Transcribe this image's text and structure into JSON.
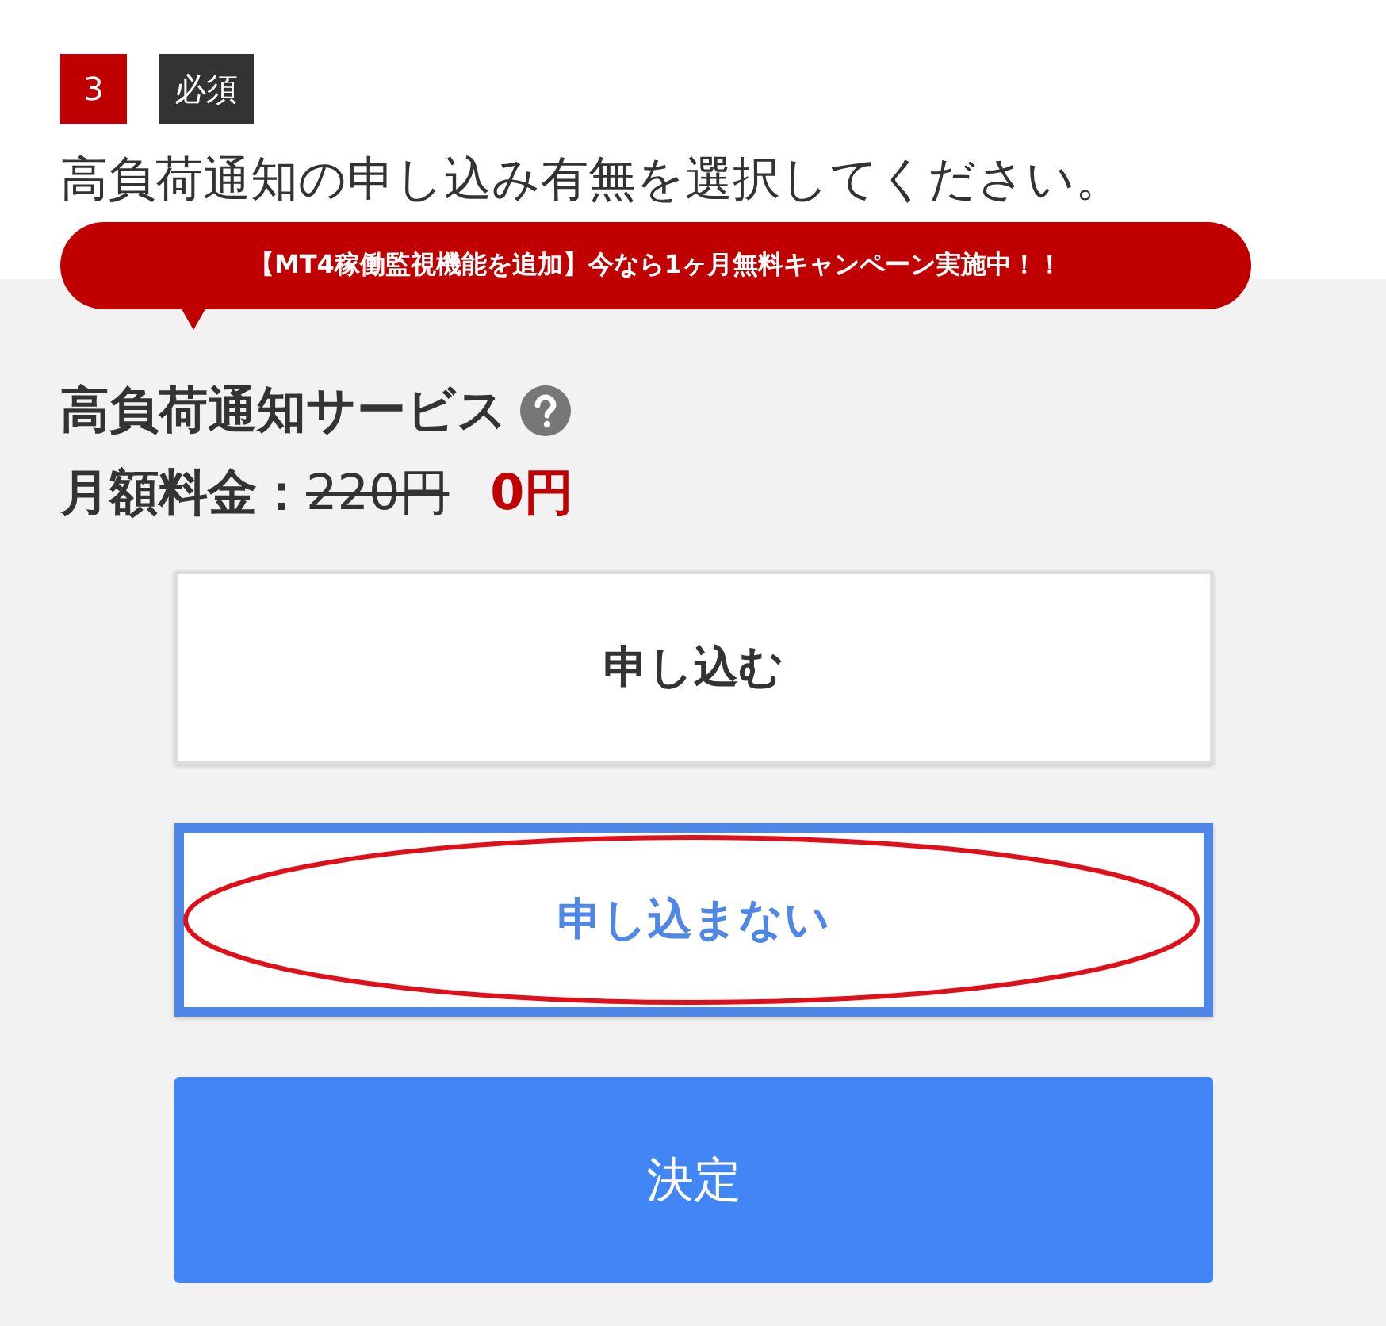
{
  "step": {
    "number": "3",
    "required_badge": "必須"
  },
  "question": "高負荷通知の申し込み有無を選択してください。",
  "campaign_bubble": "【MT4稼働監視機能を追加】今なら1ヶ月無料キャンペーン実施中！！",
  "service": {
    "title": "高負荷通知サービス",
    "price_label": "月額料金：",
    "old_price": "220円",
    "new_price": "0円"
  },
  "options": [
    {
      "label": "申し込む",
      "selected": false,
      "circled": false
    },
    {
      "label": "申し込まない",
      "selected": true,
      "circled": true
    }
  ],
  "submit_button": "決定"
}
